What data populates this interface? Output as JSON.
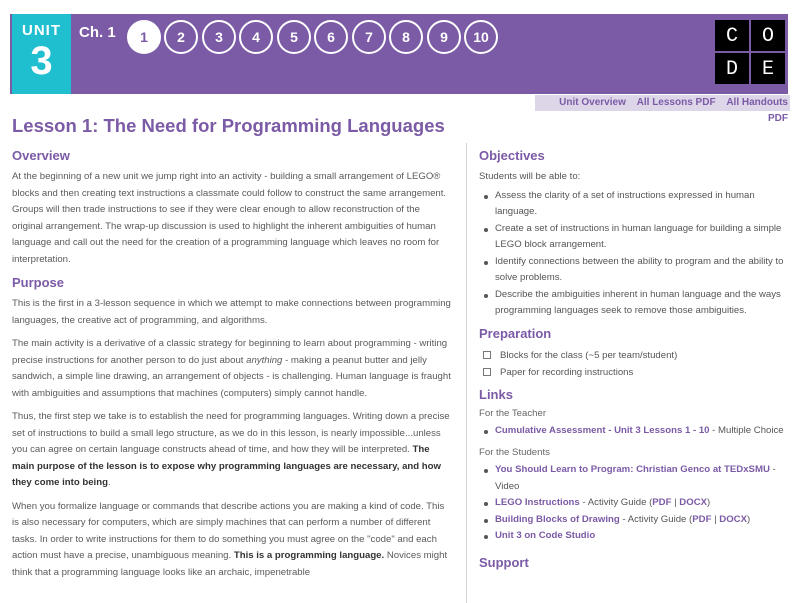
{
  "header": {
    "unit_label": "UNIT",
    "unit_number": "3",
    "chapter": "Ch. 1",
    "lessons": [
      "1",
      "2",
      "3",
      "4",
      "5",
      "6",
      "7",
      "8",
      "9",
      "10"
    ],
    "active_lesson": "1",
    "logo_letters": [
      "C",
      "O",
      "D",
      "E"
    ]
  },
  "top_links": {
    "unit_overview": "Unit Overview",
    "all_lessons": "All Lessons PDF",
    "all_handouts": "All Handouts PDF"
  },
  "lesson_title": "Lesson 1: The Need for Programming Languages",
  "overview": {
    "heading": "Overview",
    "text": "At the beginning of a new unit we jump right into an activity - building a small arrangement of LEGO® blocks and then creating text instructions a classmate could follow to construct the same arrangement. Groups will then trade instructions to see if they were clear enough to allow reconstruction of the original arrangement. The wrap-up discussion is used to highlight the inherent ambiguities of human language and call out the need for the creation of a programming language which leaves no room for interpretation."
  },
  "purpose": {
    "heading": "Purpose",
    "p1": "This is the first in a 3-lesson sequence in which we attempt to make connections between programming languages, the creative act of programming, and algorithms.",
    "p2a": "The main activity is a derivative of a classic strategy for beginning to learn about programming - writing precise instructions for another person to do just about ",
    "p2i": "anything",
    "p2b": " - making a peanut butter and jelly sandwich, a simple line drawing, an arrangement of objects - is challenging. Human language is fraught with ambiguities and assumptions that machines (computers) simply cannot handle.",
    "p3a": "Thus, the first step we take is to establish the need for programming languages. Writing down a precise set of instructions to build a small lego structure, as we do in this lesson, is nearly impossible...unless you can agree on certain language constructs ahead of time, and how they will be interpreted. ",
    "p3b": "The main purpose of the lesson is to expose why programming languages are necessary, and how they come into being",
    "p3c": ".",
    "p4a": "When you formalize language or commands that describe actions you are making a kind of code. This is also necessary for computers, which are simply machines that can perform a number of different tasks. In order to write instructions for them to do something you must agree on the \"code\" and each action must have a precise, unambiguous meaning. ",
    "p4b": "This is a programming language.",
    "p4c": " Novices might think that a programming language looks like an archaic, impenetrable"
  },
  "objectives": {
    "heading": "Objectives",
    "intro": "Students will be able to:",
    "items": [
      "Assess the clarity of a set of instructions expressed in human language.",
      "Create a set of instructions in human language for building a simple LEGO block arrangement.",
      "Identify connections between the ability to program and the ability to solve problems.",
      "Describe the ambiguities inherent in human language and the ways programming languages seek to remove those ambiguities."
    ]
  },
  "preparation": {
    "heading": "Preparation",
    "items": [
      "Blocks for the class (~5 per team/student)",
      "Paper for recording instructions"
    ]
  },
  "links": {
    "heading": "Links",
    "teacher_label": "For the Teacher",
    "teacher_link": "Cumulative Assessment - Unit 3 Lessons 1 - 10",
    "teacher_suffix": " - Multiple Choice",
    "students_label": "For the Students",
    "s1_link": "You Should Learn to Program: Christian Genco at TEDxSMU",
    "s1_suffix": " - Video",
    "s2_link": "LEGO Instructions",
    "s2_mid": " - Activity Guide (",
    "s2_pdf": "PDF",
    "s2_sep": " | ",
    "s2_docx": "DOCX",
    "s2_end": ")",
    "s3_link": "Building Blocks of Drawing",
    "s3_mid": " - Activity Guide (",
    "s3_pdf": "PDF",
    "s3_sep": " | ",
    "s3_docx": "DOCX",
    "s3_end": ")",
    "s4_link": "Unit 3 on Code Studio"
  },
  "support": {
    "heading": "Support"
  },
  "colors": {
    "header_purple": "#7b5aa6",
    "unit_teal": "#1fbfcf"
  }
}
